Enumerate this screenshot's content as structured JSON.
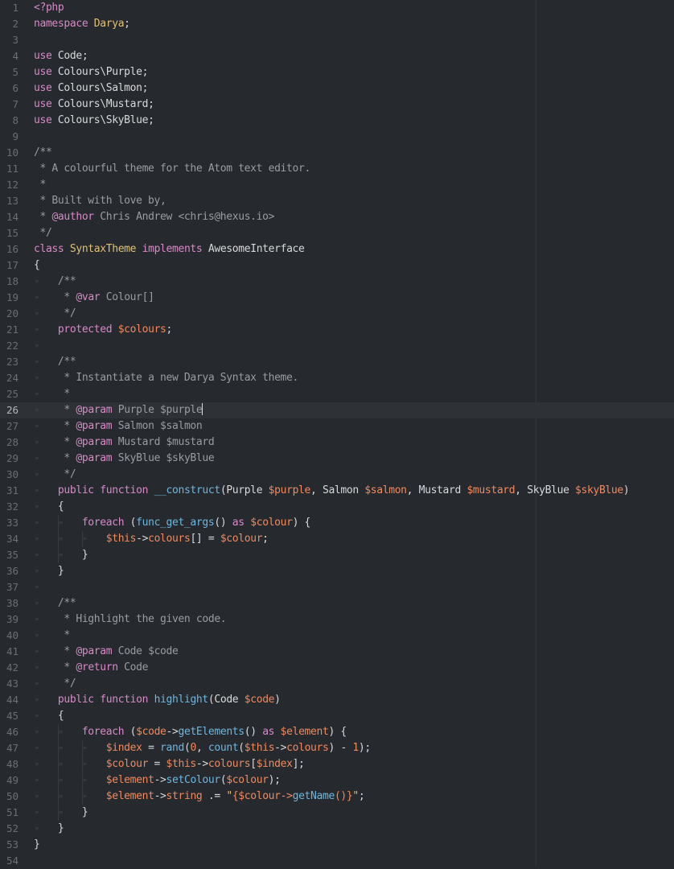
{
  "editor": {
    "cursor_line": 26,
    "colors": {
      "background": "#26292e",
      "keyword": "#d889c8",
      "class": "#e0c177",
      "variable": "#ee8a60",
      "function": "#6fb6de",
      "comment": "#9a9c9f",
      "text": "#d8d9da"
    },
    "lines": [
      [
        {
          "t": "<?php",
          "c": "kw"
        }
      ],
      [
        {
          "t": "namespace",
          "c": "kw"
        },
        {
          "t": " "
        },
        {
          "t": "Darya",
          "c": "ns"
        },
        {
          "t": ";"
        }
      ],
      [],
      [
        {
          "t": "use",
          "c": "kw"
        },
        {
          "t": " Code;"
        }
      ],
      [
        {
          "t": "use",
          "c": "kw"
        },
        {
          "t": " Colours\\Purple;"
        }
      ],
      [
        {
          "t": "use",
          "c": "kw"
        },
        {
          "t": " Colours\\Salmon;"
        }
      ],
      [
        {
          "t": "use",
          "c": "kw"
        },
        {
          "t": " Colours\\Mustard;"
        }
      ],
      [
        {
          "t": "use",
          "c": "kw"
        },
        {
          "t": " Colours\\SkyBlue;"
        }
      ],
      [],
      [
        {
          "t": "/**",
          "c": "cm"
        }
      ],
      [
        {
          "t": " * A colourful theme for the Atom text editor.",
          "c": "cm"
        }
      ],
      [
        {
          "t": " *",
          "c": "cm"
        }
      ],
      [
        {
          "t": " * Built with love by,",
          "c": "cm"
        }
      ],
      [
        {
          "t": " * ",
          "c": "cm"
        },
        {
          "t": "@author",
          "c": "doc"
        },
        {
          "t": " Chris Andrew <chris@hexus.io>",
          "c": "cm"
        }
      ],
      [
        {
          "t": " */",
          "c": "cm"
        }
      ],
      [
        {
          "t": "class",
          "c": "kw"
        },
        {
          "t": " "
        },
        {
          "t": "SyntaxTheme",
          "c": "cls"
        },
        {
          "t": " "
        },
        {
          "t": "implements",
          "c": "kw"
        },
        {
          "t": " "
        },
        {
          "t": "AwesomeInterface",
          "c": "pl"
        }
      ],
      [
        {
          "t": "{"
        }
      ],
      [
        {
          "t": "    "
        },
        {
          "t": "/**",
          "c": "cm"
        }
      ],
      [
        {
          "t": "    "
        },
        {
          "t": " * ",
          "c": "cm"
        },
        {
          "t": "@var",
          "c": "doc"
        },
        {
          "t": " Colour[]",
          "c": "cm"
        }
      ],
      [
        {
          "t": "    "
        },
        {
          "t": " */",
          "c": "cm"
        }
      ],
      [
        {
          "t": "    "
        },
        {
          "t": "protected",
          "c": "kw"
        },
        {
          "t": " "
        },
        {
          "t": "$colours",
          "c": "var"
        },
        {
          "t": ";"
        }
      ],
      [],
      [
        {
          "t": "    "
        },
        {
          "t": "/**",
          "c": "cm"
        }
      ],
      [
        {
          "t": "    "
        },
        {
          "t": " * Instantiate a new Darya Syntax theme.",
          "c": "cm"
        }
      ],
      [
        {
          "t": "    "
        },
        {
          "t": " *",
          "c": "cm"
        }
      ],
      [
        {
          "t": "    "
        },
        {
          "t": " * ",
          "c": "cm"
        },
        {
          "t": "@param",
          "c": "doc"
        },
        {
          "t": " Purple $purple",
          "c": "cm"
        }
      ],
      [
        {
          "t": "    "
        },
        {
          "t": " * ",
          "c": "cm"
        },
        {
          "t": "@param",
          "c": "doc"
        },
        {
          "t": " Salmon $salmon",
          "c": "cm"
        }
      ],
      [
        {
          "t": "    "
        },
        {
          "t": " * ",
          "c": "cm"
        },
        {
          "t": "@param",
          "c": "doc"
        },
        {
          "t": " Mustard $mustard",
          "c": "cm"
        }
      ],
      [
        {
          "t": "    "
        },
        {
          "t": " * ",
          "c": "cm"
        },
        {
          "t": "@param",
          "c": "doc"
        },
        {
          "t": " SkyBlue $skyBlue",
          "c": "cm"
        }
      ],
      [
        {
          "t": "    "
        },
        {
          "t": " */",
          "c": "cm"
        }
      ],
      [
        {
          "t": "    "
        },
        {
          "t": "public",
          "c": "kw"
        },
        {
          "t": " "
        },
        {
          "t": "function",
          "c": "kw"
        },
        {
          "t": " "
        },
        {
          "t": "__construct",
          "c": "fn"
        },
        {
          "t": "(Purple "
        },
        {
          "t": "$purple",
          "c": "var"
        },
        {
          "t": ", Salmon "
        },
        {
          "t": "$salmon",
          "c": "var"
        },
        {
          "t": ", Mustard "
        },
        {
          "t": "$mustard",
          "c": "var"
        },
        {
          "t": ", SkyBlue "
        },
        {
          "t": "$skyBlue",
          "c": "var"
        },
        {
          "t": ")"
        }
      ],
      [
        {
          "t": "    {"
        }
      ],
      [
        {
          "t": "        "
        },
        {
          "t": "foreach",
          "c": "kw"
        },
        {
          "t": " ("
        },
        {
          "t": "func_get_args",
          "c": "fn"
        },
        {
          "t": "() "
        },
        {
          "t": "as",
          "c": "kw"
        },
        {
          "t": " "
        },
        {
          "t": "$colour",
          "c": "var"
        },
        {
          "t": ") {"
        }
      ],
      [
        {
          "t": "            "
        },
        {
          "t": "$this",
          "c": "var"
        },
        {
          "t": "->"
        },
        {
          "t": "colours",
          "c": "prop"
        },
        {
          "t": "[] = "
        },
        {
          "t": "$colour",
          "c": "var"
        },
        {
          "t": ";"
        }
      ],
      [
        {
          "t": "        }"
        }
      ],
      [
        {
          "t": "    }"
        }
      ],
      [],
      [
        {
          "t": "    "
        },
        {
          "t": "/**",
          "c": "cm"
        }
      ],
      [
        {
          "t": "    "
        },
        {
          "t": " * Highlight the given code.",
          "c": "cm"
        }
      ],
      [
        {
          "t": "    "
        },
        {
          "t": " *",
          "c": "cm"
        }
      ],
      [
        {
          "t": "    "
        },
        {
          "t": " * ",
          "c": "cm"
        },
        {
          "t": "@param",
          "c": "doc"
        },
        {
          "t": " Code $code",
          "c": "cm"
        }
      ],
      [
        {
          "t": "    "
        },
        {
          "t": " * ",
          "c": "cm"
        },
        {
          "t": "@return",
          "c": "doc"
        },
        {
          "t": " Code",
          "c": "cm"
        }
      ],
      [
        {
          "t": "    "
        },
        {
          "t": " */",
          "c": "cm"
        }
      ],
      [
        {
          "t": "    "
        },
        {
          "t": "public",
          "c": "kw"
        },
        {
          "t": " "
        },
        {
          "t": "function",
          "c": "kw"
        },
        {
          "t": " "
        },
        {
          "t": "highlight",
          "c": "fn"
        },
        {
          "t": "(Code "
        },
        {
          "t": "$code",
          "c": "var"
        },
        {
          "t": ")"
        }
      ],
      [
        {
          "t": "    {"
        }
      ],
      [
        {
          "t": "        "
        },
        {
          "t": "foreach",
          "c": "kw"
        },
        {
          "t": " ("
        },
        {
          "t": "$code",
          "c": "var"
        },
        {
          "t": "->"
        },
        {
          "t": "getElements",
          "c": "fn"
        },
        {
          "t": "() "
        },
        {
          "t": "as",
          "c": "kw"
        },
        {
          "t": " "
        },
        {
          "t": "$element",
          "c": "var"
        },
        {
          "t": ") {"
        }
      ],
      [
        {
          "t": "            "
        },
        {
          "t": "$index",
          "c": "var"
        },
        {
          "t": " = "
        },
        {
          "t": "rand",
          "c": "fn"
        },
        {
          "t": "("
        },
        {
          "t": "0",
          "c": "num"
        },
        {
          "t": ", "
        },
        {
          "t": "count",
          "c": "fn"
        },
        {
          "t": "("
        },
        {
          "t": "$this",
          "c": "var"
        },
        {
          "t": "->"
        },
        {
          "t": "colours",
          "c": "prop"
        },
        {
          "t": ") - "
        },
        {
          "t": "1",
          "c": "num"
        },
        {
          "t": ");"
        }
      ],
      [
        {
          "t": "            "
        },
        {
          "t": "$colour",
          "c": "var"
        },
        {
          "t": " = "
        },
        {
          "t": "$this",
          "c": "var"
        },
        {
          "t": "->"
        },
        {
          "t": "colours",
          "c": "prop"
        },
        {
          "t": "["
        },
        {
          "t": "$index",
          "c": "var"
        },
        {
          "t": "];"
        }
      ],
      [
        {
          "t": "            "
        },
        {
          "t": "$element",
          "c": "var"
        },
        {
          "t": "->"
        },
        {
          "t": "setColour",
          "c": "fn"
        },
        {
          "t": "("
        },
        {
          "t": "$colour",
          "c": "var"
        },
        {
          "t": ");"
        }
      ],
      [
        {
          "t": "            "
        },
        {
          "t": "$element",
          "c": "var"
        },
        {
          "t": "->"
        },
        {
          "t": "string",
          "c": "prop"
        },
        {
          "t": " .= "
        },
        {
          "t": "\"",
          "c": "str"
        },
        {
          "t": "{$colour->",
          "c": "var"
        },
        {
          "t": "getName",
          "c": "fn"
        },
        {
          "t": "()}",
          "c": "var"
        },
        {
          "t": "\"",
          "c": "str"
        },
        {
          "t": ";"
        }
      ],
      [
        {
          "t": "        }"
        }
      ],
      [
        {
          "t": "    }"
        }
      ],
      [
        {
          "t": "}"
        }
      ],
      []
    ]
  }
}
